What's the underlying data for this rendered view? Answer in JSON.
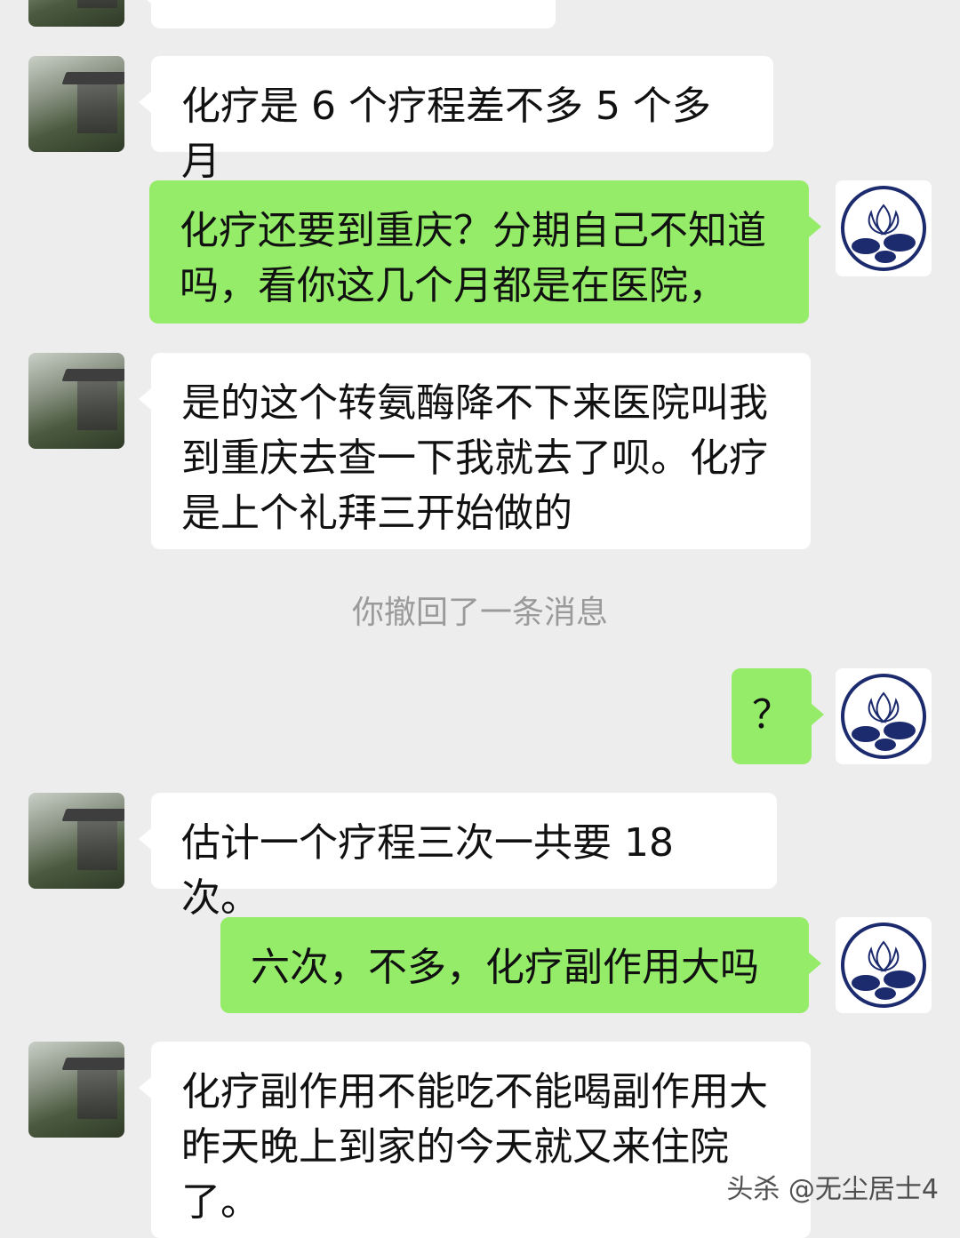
{
  "colors": {
    "background": "#ededed",
    "incoming_bubble": "#ffffff",
    "outgoing_bubble": "#95ec69",
    "system_text": "#9a9a9a"
  },
  "messages": [
    {
      "side": "in",
      "text": ""
    },
    {
      "side": "in",
      "text": "化疗是 6 个疗程差不多 5 个多月"
    },
    {
      "side": "out",
      "text": "化疗还要到重庆？分期自己不知道吗，看你这几个月都是在医院，"
    },
    {
      "side": "in",
      "text": "是的这个转氨酶降不下来医院叫我到重庆去查一下我就去了呗。化疗是上个礼拜三开始做的"
    },
    {
      "side": "out",
      "text": "？"
    },
    {
      "side": "in",
      "text": "估计一个疗程三次一共要 18 次。"
    },
    {
      "side": "out",
      "text": "六次，不多，化疗副作用大吗"
    },
    {
      "side": "in",
      "text": "化疗副作用不能吃不能喝副作用大昨天晚上到家的今天就又来住院了。"
    }
  ],
  "system": {
    "recall_notice": "你撤回了一条消息"
  },
  "watermark": "头杀 @无尘居士4",
  "icons": {
    "contact_avatar": "pavilion-photo-avatar",
    "self_avatar": "lotus-avatar"
  }
}
